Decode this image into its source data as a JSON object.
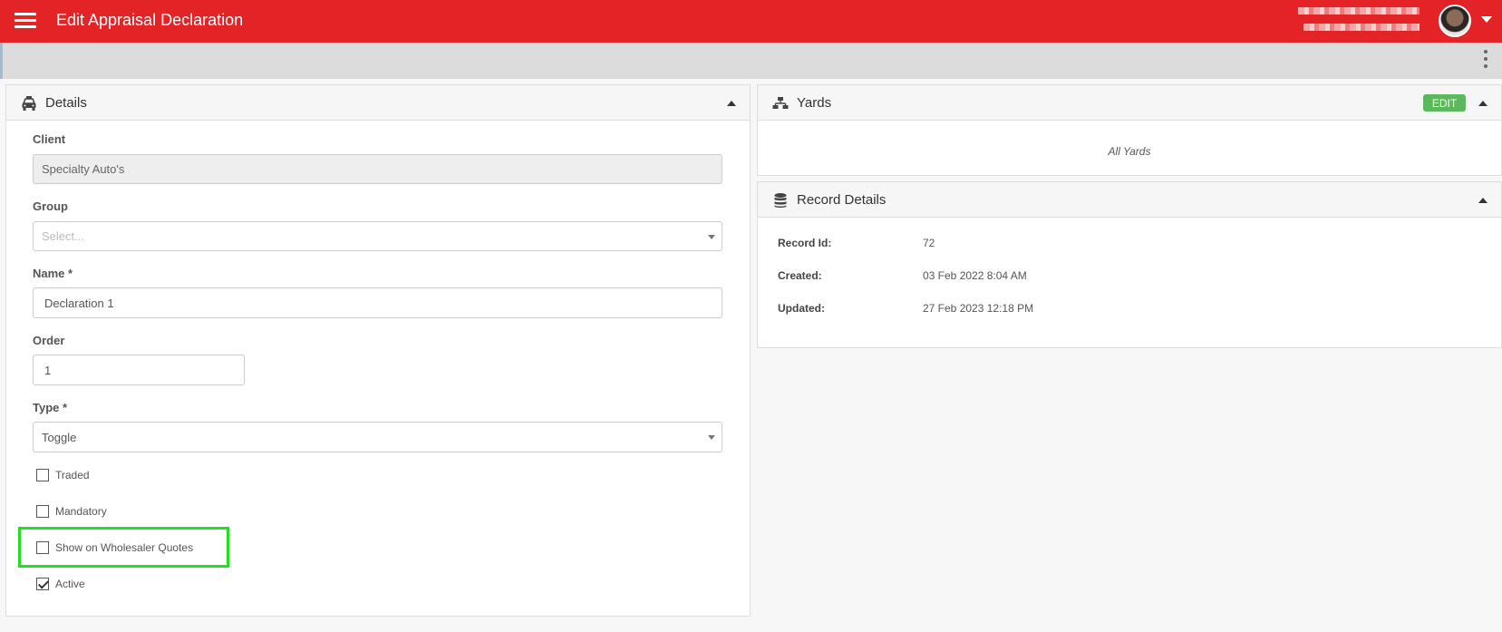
{
  "header": {
    "title": "Edit Appraisal Declaration",
    "menu_icon": "hamburger-menu-icon",
    "user_avatar": "avatar",
    "user_menu_icon": "chevron-down-icon"
  },
  "subbar": {
    "more_icon": "kebab-menu-icon"
  },
  "details": {
    "title": "Details",
    "icon": "car-icon",
    "client_label": "Client",
    "client_value": "Specialty Auto's",
    "group_label": "Group",
    "group_placeholder": "Select...",
    "name_label": "Name *",
    "name_value": "Declaration 1",
    "order_label": "Order",
    "order_value": "1",
    "type_label": "Type *",
    "type_value": "Toggle",
    "checkboxes": [
      {
        "label": "Traded",
        "checked": false
      },
      {
        "label": "Mandatory",
        "checked": false
      },
      {
        "label": "Show on Wholesaler Quotes",
        "checked": false
      },
      {
        "label": "Active",
        "checked": true
      }
    ]
  },
  "yards": {
    "title": "Yards",
    "icon": "sitemap-icon",
    "edit_label": "EDIT",
    "all_yards_text": "All Yards"
  },
  "record_details": {
    "title": "Record Details",
    "icon": "database-icon",
    "rows": [
      {
        "label": "Record Id:",
        "value": "72"
      },
      {
        "label": "Created:",
        "value": "03 Feb 2022 8:04 AM"
      },
      {
        "label": "Updated:",
        "value": "27 Feb 2023 12:18 PM"
      }
    ]
  },
  "colors": {
    "header_red": "#e42327",
    "edit_green": "#5cb85c",
    "highlight_green": "#22e01e"
  }
}
